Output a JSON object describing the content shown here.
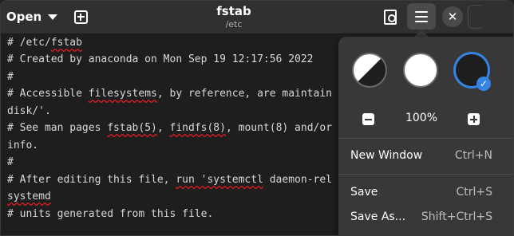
{
  "header": {
    "open_label": "Open",
    "title": "fstab",
    "subtitle": "/etc",
    "close_glyph": "✕"
  },
  "icons": {
    "open_menu": "chevron-down-icon",
    "new_tab": "new-tab-icon",
    "find": "document-search-icon",
    "main_menu": "hamburger-menu-icon",
    "close": "close-icon",
    "selected": "checkmark-icon"
  },
  "editor": {
    "lines": [
      "# /etc/fstab",
      "# Created by anaconda on Mon Sep 19 12:17:56 2022",
      "#",
      "# Accessible filesystems, by reference, are maintain",
      "disk/'.",
      "# See man pages fstab(5), findfs(8), mount(8) and/or",
      "info.",
      "#",
      "# After editing this file, run 'systemctl daemon-rel",
      "systemd",
      "# units generated from this file."
    ]
  },
  "menu": {
    "style_schemes": [
      "System",
      "Light",
      "Dark"
    ],
    "selected_scheme": "Dark",
    "checkmark": "✓",
    "zoom_level": "100%",
    "items": [
      {
        "label": "New Window",
        "shortcut": "Ctrl+N"
      },
      {
        "label": "Save",
        "shortcut": "Ctrl+S"
      },
      {
        "label": "Save As...",
        "shortcut": "Shift+Ctrl+S"
      }
    ]
  },
  "colors": {
    "accent": "#3584e4",
    "header_bg": "#303030",
    "editor_bg": "#1e1e1e",
    "popover_bg": "#383838",
    "spell_error": "#e01b24"
  }
}
